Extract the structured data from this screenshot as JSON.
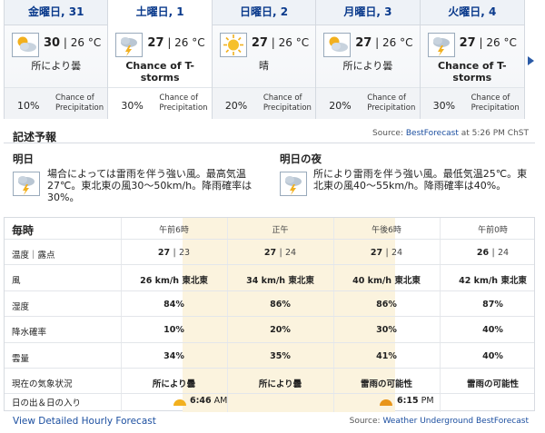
{
  "days": [
    {
      "label": "金曜日, 31",
      "hi": "30",
      "lo": "26",
      "unit": "°C",
      "icon": "partly-cloudy-icon",
      "cond": "所により曇",
      "bold": false,
      "pct": "10%",
      "pl1": "Chance of",
      "pl2": "Precipitation",
      "active": false
    },
    {
      "label": "土曜日, 1",
      "hi": "27",
      "lo": "26",
      "unit": "°C",
      "icon": "thunderstorm-icon",
      "cond": "Chance of T-storms",
      "bold": true,
      "pct": "30%",
      "pl1": "Chance of",
      "pl2": "Precipitation",
      "active": true
    },
    {
      "label": "日曜日, 2",
      "hi": "27",
      "lo": "26",
      "unit": "°C",
      "icon": "sunny-icon",
      "cond": "晴",
      "bold": false,
      "pct": "20%",
      "pl1": "Chance of",
      "pl2": "Precipitation",
      "active": false
    },
    {
      "label": "月曜日, 3",
      "hi": "27",
      "lo": "26",
      "unit": "°C",
      "icon": "partly-cloudy-icon",
      "cond": "所により曇",
      "bold": false,
      "pct": "20%",
      "pl1": "Chance of",
      "pl2": "Precipitation",
      "active": false
    },
    {
      "label": "火曜日, 4",
      "hi": "27",
      "lo": "26",
      "unit": "°C",
      "icon": "thunderstorm-icon",
      "cond": "Chance of T-storms",
      "bold": true,
      "pct": "30%",
      "pl1": "Chance of",
      "pl2": "Precipitation",
      "active": false
    }
  ],
  "narrative": {
    "title": "記述予報",
    "source_prefix": "Source:",
    "source_link": "BestForecast",
    "source_suffix": "at 5:26 PM ChST",
    "day_title": "明日",
    "day_text1": "場合によっては雷雨を伴う強い風。最高気温",
    "day_text2": "27℃。東北東の風30～50km/h。降雨確率は",
    "day_text3": "30%。",
    "night_title": "明日の夜",
    "night_text1": "所により雷雨を伴う強い風。最低気温25℃。東",
    "night_text2": "北東の風40～55km/h。降雨確率は40%。"
  },
  "hourly": {
    "title": "毎時",
    "times": [
      "午前6時",
      "正午",
      "午後6時",
      "午前0時"
    ],
    "rows": [
      {
        "label": "温度｜露点",
        "cells": [
          [
            "27",
            "23"
          ],
          [
            "27",
            "24"
          ],
          [
            "27",
            "24"
          ],
          [
            "26",
            "24"
          ]
        ],
        "split": true
      },
      {
        "label": "風",
        "cells": [
          "26 km/h 東北東",
          "34 km/h 東北東",
          "40 km/h 東北東",
          "42 km/h 東北東"
        ]
      },
      {
        "label": "湿度",
        "cells": [
          "84%",
          "86%",
          "86%",
          "87%"
        ]
      },
      {
        "label": "降水確率",
        "cells": [
          "10%",
          "20%",
          "30%",
          "40%"
        ]
      },
      {
        "label": "雲量",
        "cells": [
          "34%",
          "35%",
          "41%",
          "40%"
        ]
      },
      {
        "label": "現在の気象状況",
        "cells": [
          "所により曇",
          "所により曇",
          "雷雨の可能性",
          "雷雨の可能性"
        ]
      }
    ],
    "sun_label": "日の出＆日の入り",
    "sunrise_time": "6:46",
    "sunrise_ampm": "AM",
    "sunset_time": "6:15",
    "sunset_ampm": "PM"
  },
  "footer": {
    "link": "View Detailed Hourly Forecast",
    "source_prefix": "Source:",
    "source_link": "Weather Underground BestForecast"
  },
  "colors": {
    "link": "#1c4fa0",
    "shade": "#fbf3de",
    "sun": "#f2b01e",
    "sunset": "#e8951a"
  }
}
